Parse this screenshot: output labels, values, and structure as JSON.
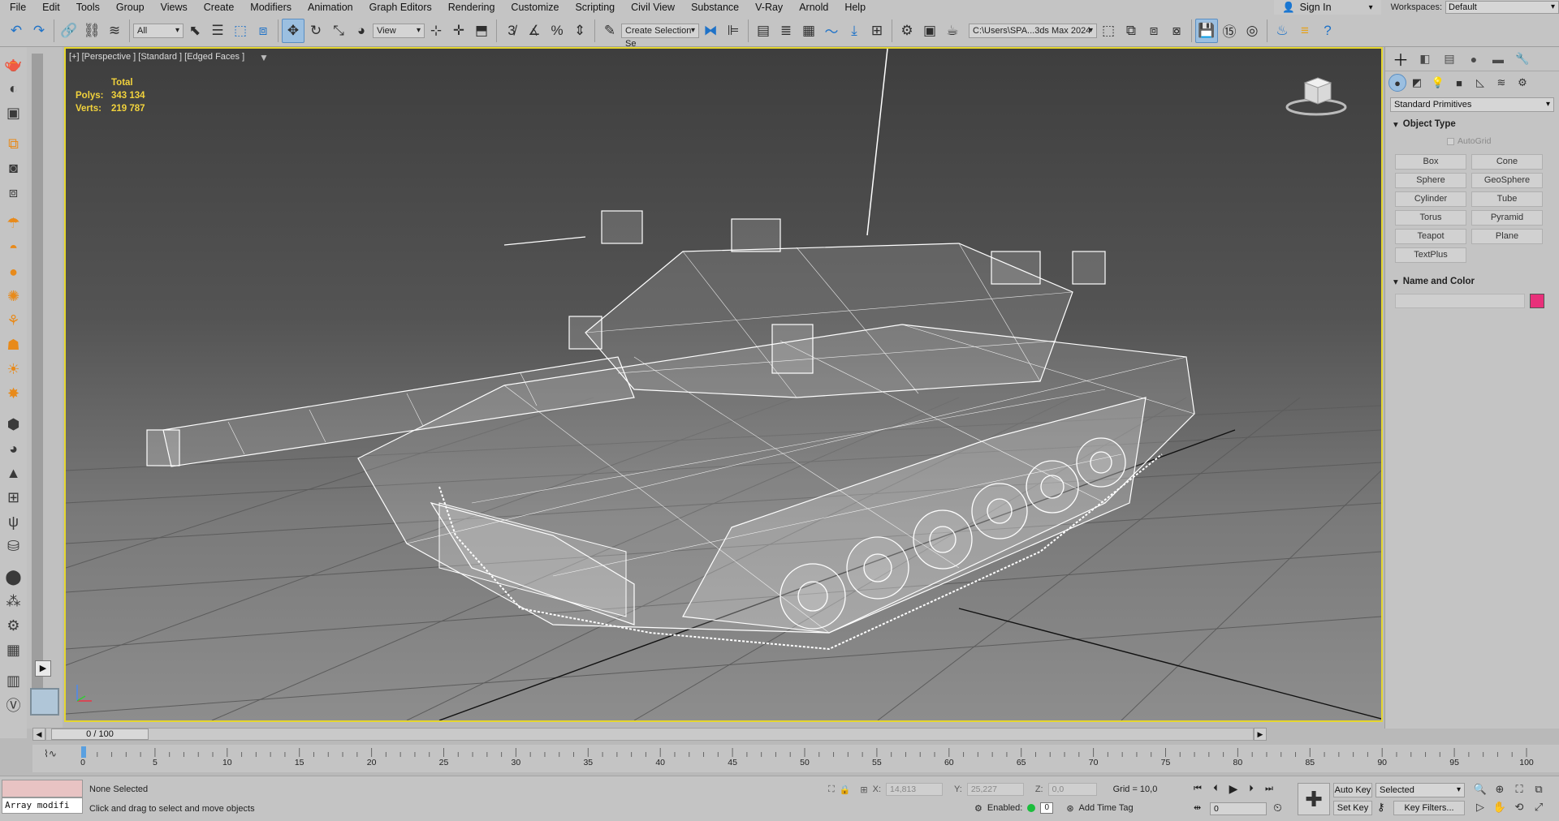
{
  "menu": {
    "items": [
      "File",
      "Edit",
      "Tools",
      "Group",
      "Views",
      "Create",
      "Modifiers",
      "Animation",
      "Graph Editors",
      "Rendering",
      "Customize",
      "Scripting",
      "Civil View",
      "Substance",
      "V-Ray",
      "Arnold",
      "Help"
    ],
    "sign_in": "Sign In",
    "workspaces_label": "Workspaces:",
    "workspace_value": "Default"
  },
  "toolbar": {
    "selection_filter": "All",
    "ref_coord": "View",
    "named_selection": "Create Selection Se",
    "project_path": "C:\\Users\\SPA...3ds Max 2024"
  },
  "viewport": {
    "label": "[+] [Perspective ] [Standard ] [Edged Faces ]",
    "stats_title": "Total",
    "polys_label": "Polys:",
    "polys_value": "343 134",
    "verts_label": "Verts:",
    "verts_value": "219 787"
  },
  "command_panel": {
    "category": "Standard Primitives",
    "object_type_title": "Object Type",
    "autogrid_label": "AutoGrid",
    "primitives": [
      "Box",
      "Cone",
      "Sphere",
      "GeoSphere",
      "Cylinder",
      "Tube",
      "Torus",
      "Pyramid",
      "Teapot",
      "Plane",
      "TextPlus"
    ],
    "name_color_title": "Name and Color",
    "object_color": "#e8307a"
  },
  "timeline": {
    "slider_text": "0 / 100",
    "ticks": [
      "0",
      "5",
      "10",
      "15",
      "20",
      "25",
      "30",
      "35",
      "40",
      "45",
      "50",
      "55",
      "60",
      "65",
      "70",
      "75",
      "80",
      "85",
      "90",
      "95",
      "100"
    ]
  },
  "status": {
    "maxscript_text": "Array modifi",
    "selection_status": "None Selected",
    "prompt": "Click and drag to select and move objects",
    "x_label": "X:",
    "x_value": "14,813",
    "y_label": "Y:",
    "y_value": "25,227",
    "z_label": "Z:",
    "z_value": "0,0",
    "grid": "Grid = 10,0",
    "enabled_label": "Enabled:",
    "enabled_value": "0",
    "add_time_tag": "Add Time Tag",
    "frame_value": "0",
    "auto_key": "Auto Key",
    "set_key": "Set Key",
    "key_mode": "Selected",
    "key_filters": "Key Filters..."
  },
  "colors": {
    "viewport_border": "#e5d630",
    "stats_text": "#f1d23c",
    "accent_blue": "#1e72c8"
  }
}
